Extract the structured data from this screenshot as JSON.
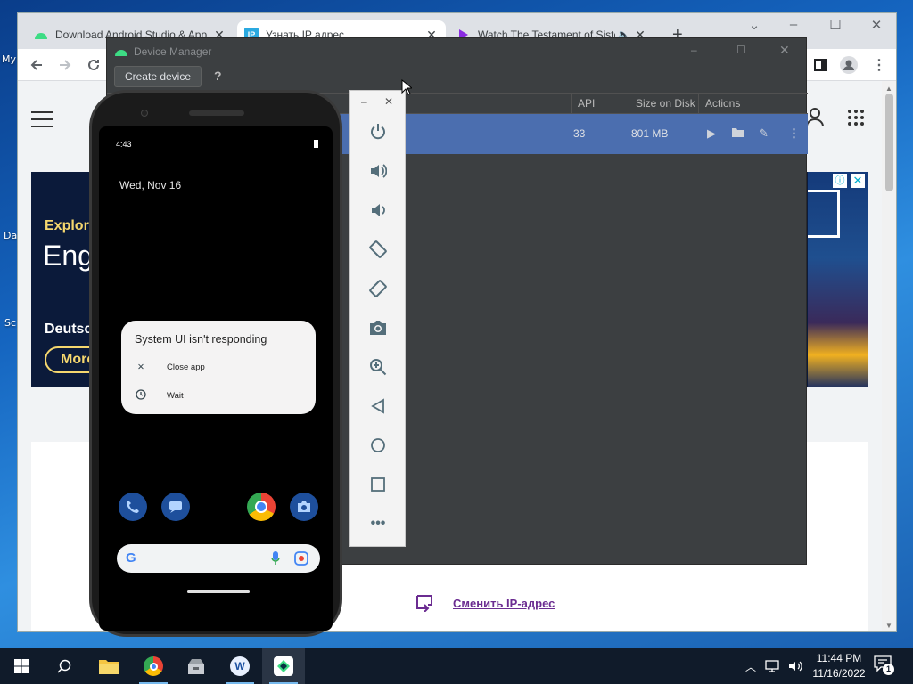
{
  "desktop": {
    "icons": [
      {
        "label": "My",
        "name": "desktop-icon-my"
      },
      {
        "label": "Da",
        "name": "desktop-icon-da"
      },
      {
        "label": "Sc",
        "name": "desktop-icon-sc"
      }
    ]
  },
  "browser": {
    "tabs": [
      {
        "title": "Download Android Studio & App",
        "favicon": "android-icon",
        "active": false
      },
      {
        "title": "Узнать IP адрес",
        "favicon": "ip-icon",
        "active": true
      },
      {
        "title": "Watch The Testament of Sister",
        "favicon": "play-icon",
        "active": false
      }
    ],
    "new_tab_label": "+",
    "ad": {
      "line1": "Explore",
      "line2": "Eng",
      "line3": "Deutsc",
      "more_label": "More"
    },
    "change_ip_link": "Сменить IP-адрес"
  },
  "device_manager": {
    "title": "Device Manager",
    "create_button": "Create device",
    "help_label": "?",
    "columns": [
      "API",
      "Size on Disk",
      "Actions"
    ],
    "row": {
      "api": "33",
      "size": "801 MB"
    }
  },
  "emulator": {
    "status_time": "4:43",
    "lock_date": "Wed, Nov 16",
    "dialog": {
      "title": "System UI isn't responding",
      "options": [
        "Close app",
        "Wait"
      ]
    },
    "search_logo": "G",
    "toolbar": [
      "power-icon",
      "volume-up-icon",
      "volume-down-icon",
      "rotate-left-icon",
      "rotate-right-icon",
      "camera-icon",
      "zoom-icon",
      "back-icon",
      "home-icon",
      "overview-icon",
      "more-icon"
    ]
  },
  "taskbar": {
    "time": "11:44 PM",
    "date": "11/16/2022",
    "notification_count": "1"
  },
  "colors": {
    "dm_background": "#3c3f41",
    "dm_selected_row": "#4b6eaf",
    "link_purple": "#6b2c91",
    "taskbar": "#101b2a"
  }
}
